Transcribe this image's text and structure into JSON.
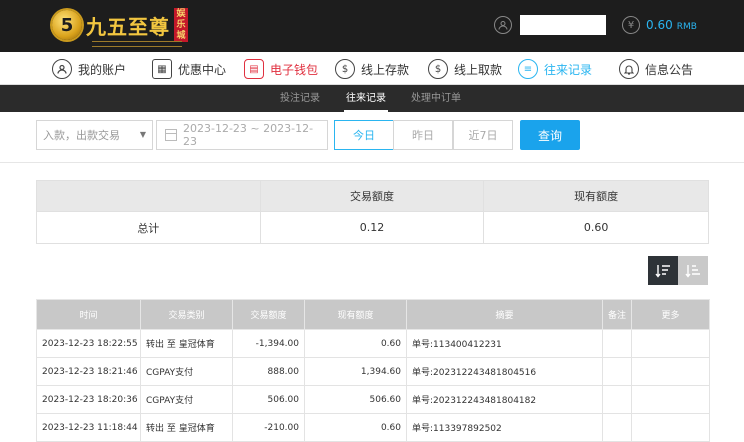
{
  "header": {
    "logo_mark": "5",
    "logo_text": "九五至尊",
    "logo_badge": "娱乐城",
    "user_icon": "user-icon",
    "balance_icon": "currency-icon",
    "balance_value": "0.60",
    "balance_unit": "RMB"
  },
  "nav": {
    "items": [
      {
        "label": "我的账户",
        "icon": "user-circle-icon"
      },
      {
        "label": "优惠中心",
        "icon": "gift-icon"
      },
      {
        "label": "电子钱包",
        "icon": "wallet-icon"
      },
      {
        "label": "线上存款",
        "icon": "deposit-icon"
      },
      {
        "label": "线上取款",
        "icon": "withdraw-icon"
      },
      {
        "label": "往来记录",
        "icon": "records-icon"
      },
      {
        "label": "信息公告",
        "icon": "bell-icon"
      }
    ]
  },
  "subnav": {
    "items": [
      "投注记录",
      "往来记录",
      "处理中订单"
    ]
  },
  "filters": {
    "type_select": "入款，出款交易",
    "date_range": "2023-12-23 ~ 2023-12-23",
    "today": "今日",
    "yesterday": "昨日",
    "last7": "近7日",
    "query": "查询"
  },
  "summary": {
    "headers": [
      "",
      "交易额度",
      "现有额度"
    ],
    "row": [
      "总计",
      "0.12",
      "0.60"
    ]
  },
  "records": {
    "headers": [
      "时间",
      "交易类别",
      "交易额度",
      "现有额度",
      "摘要",
      "备注",
      "更多"
    ],
    "rows": [
      [
        "2023-12-23 18:22:55",
        "转出 至 皇冠体育",
        "-1,394.00",
        "0.60",
        "单号:113400412231",
        "",
        ""
      ],
      [
        "2023-12-23 18:21:46",
        "CGPAY支付",
        "888.00",
        "1,394.60",
        "单号:202312243481804516",
        "",
        ""
      ],
      [
        "2023-12-23 18:20:36",
        "CGPAY支付",
        "506.00",
        "506.60",
        "单号:202312243481804182",
        "",
        ""
      ],
      [
        "2023-12-23 11:18:44",
        "转出 至 皇冠体育",
        "-210.00",
        "0.60",
        "单号:113397892502",
        "",
        ""
      ]
    ]
  },
  "colors": {
    "accent": "#2ab5f0",
    "wallet": "#e0303f",
    "header_bg": "#1d1d1d",
    "subnav_bg": "#2b2b2b"
  }
}
